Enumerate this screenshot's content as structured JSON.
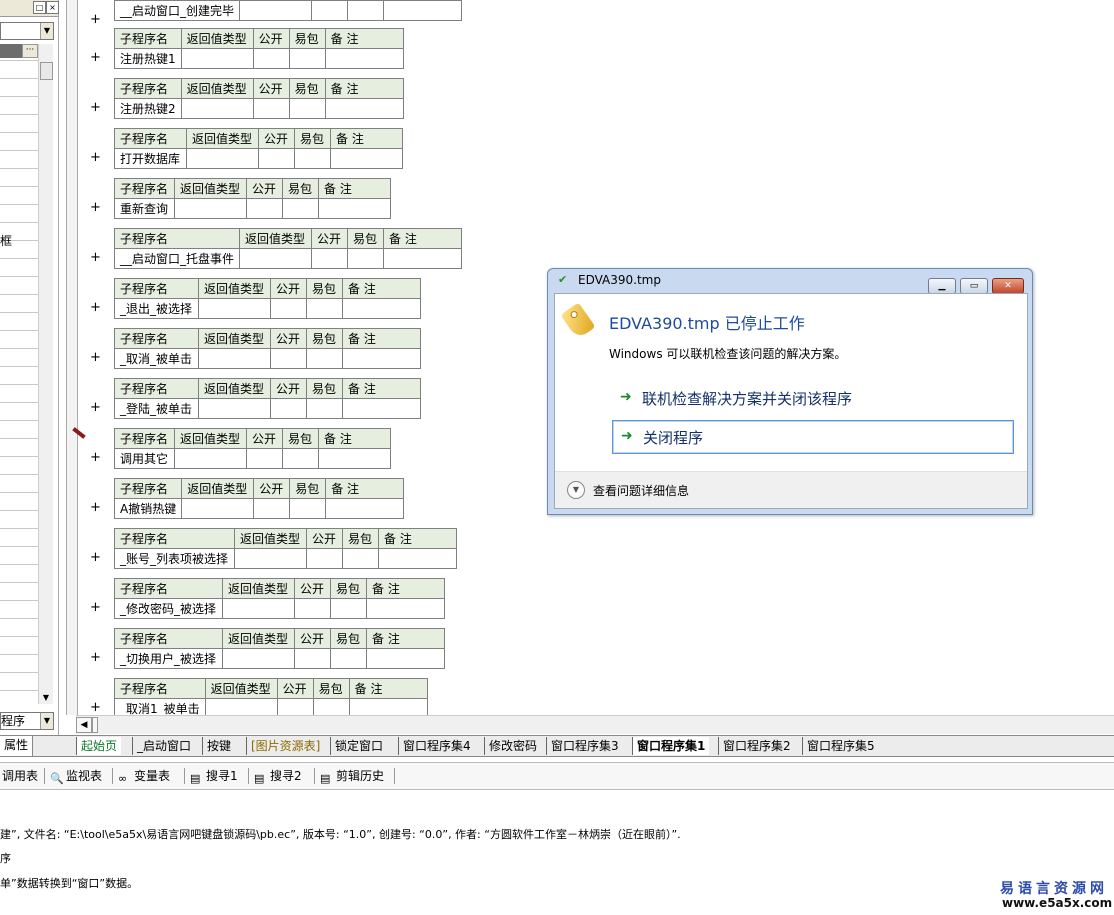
{
  "header_labels": [
    "子程序名",
    "返回值类型",
    "公开",
    "易包",
    "备 注"
  ],
  "subprograms": [
    {
      "name": "__启动窗口_创建完毕"
    },
    {
      "name": "注册热键1"
    },
    {
      "name": "注册热键2"
    },
    {
      "name": "打开数据库"
    },
    {
      "name": "重新查询"
    },
    {
      "name": "__启动窗口_托盘事件"
    },
    {
      "name": "_退出_被选择"
    },
    {
      "name": "_取消_被单击"
    },
    {
      "name": "_登陆_被单击"
    },
    {
      "name": "调用其它"
    },
    {
      "name": "A撤销热键"
    },
    {
      "name": "_账号_列表项被选择"
    },
    {
      "name": "_修改密码_被选择"
    },
    {
      "name": "_切换用户_被选择"
    },
    {
      "name": "_取消1_被单击"
    }
  ],
  "left_panel": {
    "partial_label": "框",
    "bottom_combo": "程序",
    "props_tab": "属性"
  },
  "dialog": {
    "title": "EDVA390.tmp",
    "heading": "EDVA390.tmp 已停止工作",
    "description": "Windows 可以联机检查该问题的解决方案。",
    "option1": "联机检查解决方案并关闭该程序",
    "option2": "关闭程序",
    "details": "查看问题详细信息"
  },
  "tabs": [
    "起始页",
    "_启动窗口",
    "按键",
    "[图片资源表]",
    "锁定窗口",
    "窗口程序集4",
    "修改密码",
    "窗口程序集3",
    "窗口程序集1",
    "窗口程序集2",
    "窗口程序集5"
  ],
  "active_tab": "窗口程序集1",
  "toolbar": [
    "调用表",
    "监视表",
    "变量表",
    "搜寻1",
    "搜寻2",
    "剪辑历史"
  ],
  "output": {
    "line1": "建”, 文件名: “E:\\tool\\e5a5x\\易语言网吧键盘锁源码\\pb.ec”, 版本号: “1.0”, 创建号: “0.0”, 作者: “方圆软件工作室－林炳崇（近在眼前）”.",
    "line2": "序",
    "line3": "单”数据转换到“窗口”数据。"
  },
  "watermark": {
    "name": "易语言资源网",
    "url": "www.e5a5x.com"
  }
}
